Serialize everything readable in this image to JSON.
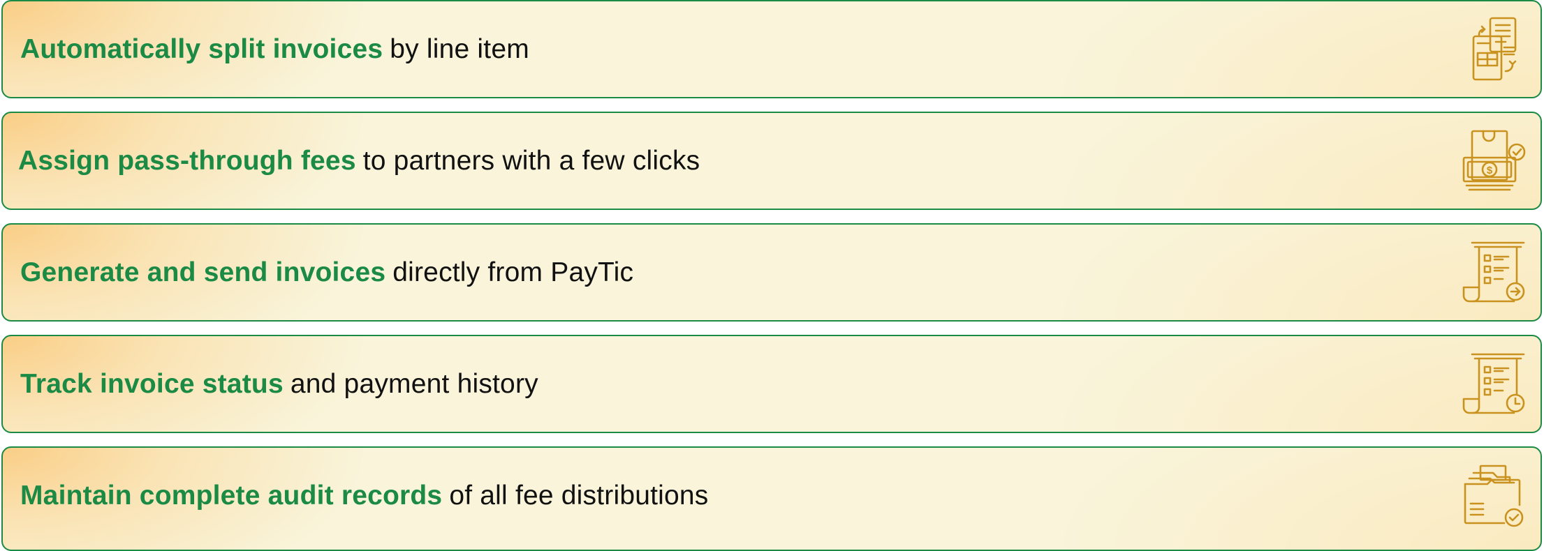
{
  "features": [
    {
      "highlight": "Automatically split invoices",
      "rest": "by line item",
      "icon": "split-invoice-icon"
    },
    {
      "highlight": "Assign pass-through fees",
      "rest": "to partners with a few clicks",
      "icon": "cash-approve-icon"
    },
    {
      "highlight": "Generate and send invoices",
      "rest": "directly from PayTic",
      "icon": "invoice-send-icon"
    },
    {
      "highlight": "Track invoice status",
      "rest": "and payment history",
      "icon": "invoice-clock-icon"
    },
    {
      "highlight": "Maintain complete audit records",
      "rest": "of all fee distributions",
      "icon": "folder-check-icon"
    }
  ],
  "colors": {
    "highlight": "#1a8a45",
    "border": "#1a8a45",
    "icon": "#c9921f",
    "text": "#111111"
  }
}
